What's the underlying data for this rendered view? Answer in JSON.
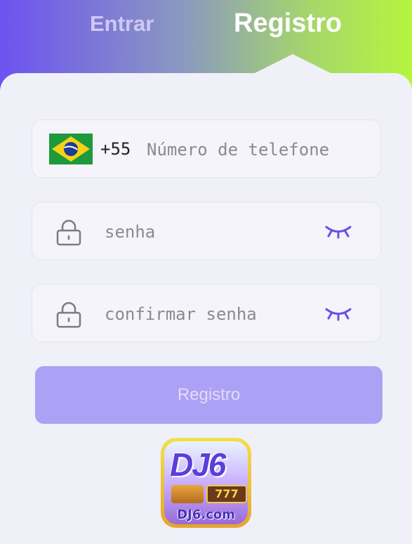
{
  "tabs": {
    "login_label": "Entrar",
    "register_label": "Registro"
  },
  "phone_field": {
    "country_flag": "brazil-flag-icon",
    "country_code": "+55",
    "placeholder": "Número de telefone",
    "value": ""
  },
  "password_field": {
    "placeholder": "senha",
    "value": ""
  },
  "confirm_field": {
    "placeholder": "confirmar senha",
    "value": ""
  },
  "submit": {
    "label": "Registro"
  },
  "logo": {
    "brand": "DJ6",
    "slot_text": "777",
    "url": "DJ6.com"
  },
  "colors": {
    "accent": "#6d52f0",
    "gradient_end": "#b4f53e",
    "button_bg": "#aca1f4",
    "eye_icon": "#6b4fe8"
  }
}
